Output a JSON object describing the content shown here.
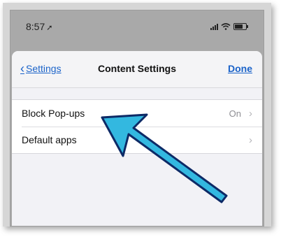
{
  "status_bar": {
    "time": "8:57",
    "location_icon": "location-arrow-icon",
    "signal_icon": "cellular-signal-icon",
    "wifi_icon": "wifi-icon",
    "battery_icon": "battery-icon",
    "battery_level": 0.75
  },
  "navbar": {
    "back_label": "Settings",
    "back_icon": "chevron-left-icon",
    "title": "Content Settings",
    "done_label": "Done"
  },
  "settings_rows": [
    {
      "label": "Block Pop-ups",
      "value": "On",
      "disclosure": "›"
    },
    {
      "label": "Default apps",
      "value": "",
      "disclosure": "›"
    }
  ],
  "annotation": {
    "arrow_color": "#33b8e0",
    "arrow_outline": "#0d2a66"
  },
  "colors": {
    "accent": "#1b63c9",
    "background": "#f2f2f6"
  }
}
